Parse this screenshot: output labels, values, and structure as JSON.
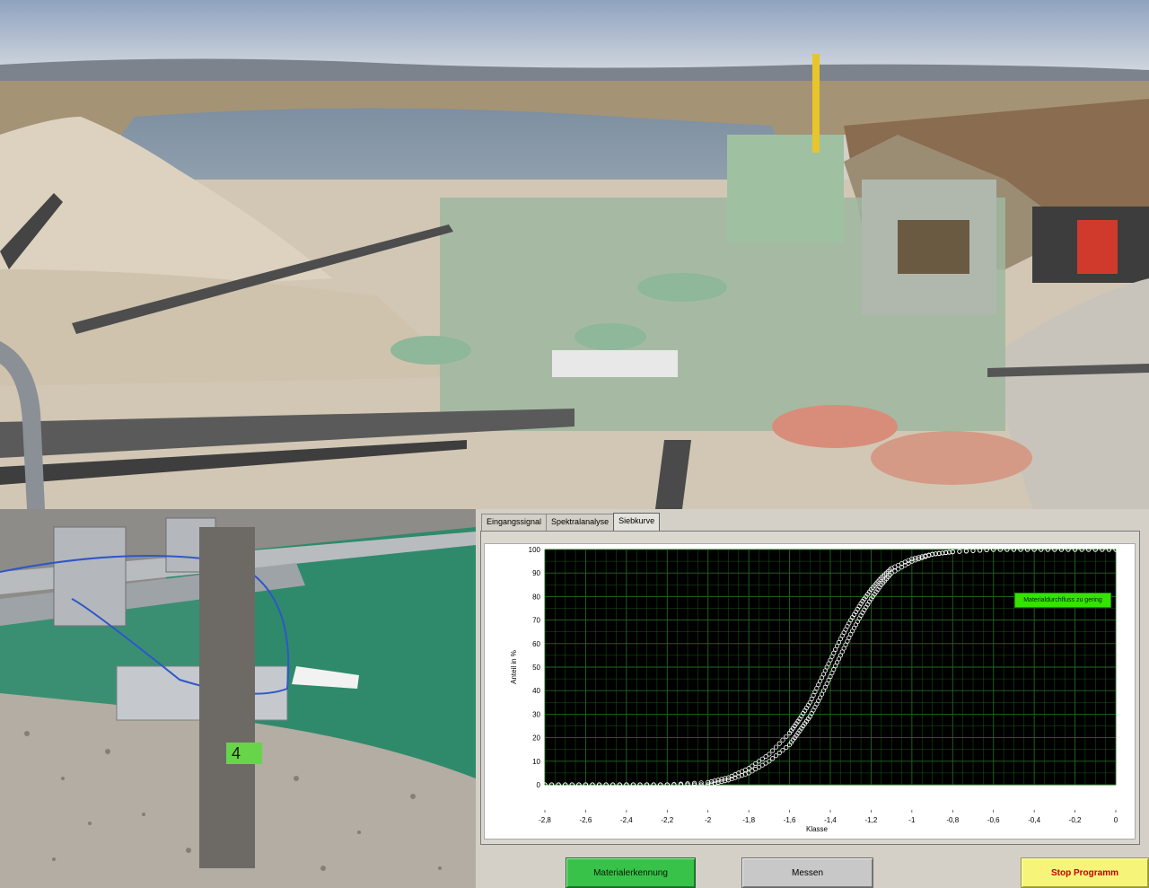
{
  "tabs": [
    {
      "label": "Eingangssignal"
    },
    {
      "label": "Spektralanalyse"
    },
    {
      "label": "Siebkurve"
    }
  ],
  "active_tab": "Siebkurve",
  "status_badge": {
    "label": "Materialdurchfluss zu gering",
    "color": "#33e400"
  },
  "buttons": {
    "material": "Materialerkennung",
    "measure": "Messen",
    "stop": "Stop Programm"
  },
  "sensor_label": "4",
  "chart_data": {
    "type": "scatter",
    "xlabel": "Klasse",
    "ylabel": "Anteil in %",
    "xlim": [
      -2.8,
      0
    ],
    "ylim": [
      0,
      100
    ],
    "xticks": [
      "-2,8",
      "-2,6",
      "-2,4",
      "-2,2",
      "-2",
      "-1,8",
      "-1,6",
      "-1,4",
      "-1,2",
      "-1",
      "-0,8",
      "-0,6",
      "-0,4",
      "-0,2",
      "0"
    ],
    "yticks": [
      "0",
      "10",
      "20",
      "30",
      "40",
      "50",
      "60",
      "70",
      "80",
      "90",
      "100"
    ],
    "grid": true,
    "background": "#000000",
    "grid_color": "#1f6b1f",
    "marker_color": "#ffffff",
    "series": [
      {
        "x": [
          -2.8,
          -2.6,
          -2.4,
          -2.2,
          -2.0,
          -1.9,
          -1.8,
          -1.7,
          -1.6,
          -1.55,
          -1.5,
          -1.45,
          -1.4,
          -1.35,
          -1.3,
          -1.25,
          -1.2,
          -1.15,
          -1.1,
          -1.0,
          -0.9,
          -0.8,
          -0.6,
          -0.4,
          -0.2,
          0
        ],
        "y": [
          0,
          0,
          0,
          0,
          1,
          3,
          7,
          13,
          22,
          28,
          35,
          44,
          53,
          62,
          70,
          77,
          83,
          88,
          92,
          96,
          98,
          99,
          100,
          100,
          100,
          100
        ]
      },
      {
        "x": [
          -2.8,
          -2.6,
          -2.4,
          -2.2,
          -2.0,
          -1.9,
          -1.8,
          -1.7,
          -1.6,
          -1.55,
          -1.5,
          -1.45,
          -1.4,
          -1.35,
          -1.3,
          -1.25,
          -1.2,
          -1.15,
          -1.1,
          -1.0,
          -0.9,
          -0.8,
          -0.6,
          -0.4,
          -0.2,
          0
        ],
        "y": [
          0,
          0,
          0,
          0,
          0,
          2,
          5,
          10,
          17,
          23,
          29,
          37,
          46,
          55,
          64,
          72,
          79,
          85,
          90,
          95,
          98,
          99,
          100,
          100,
          100,
          100
        ]
      }
    ]
  }
}
